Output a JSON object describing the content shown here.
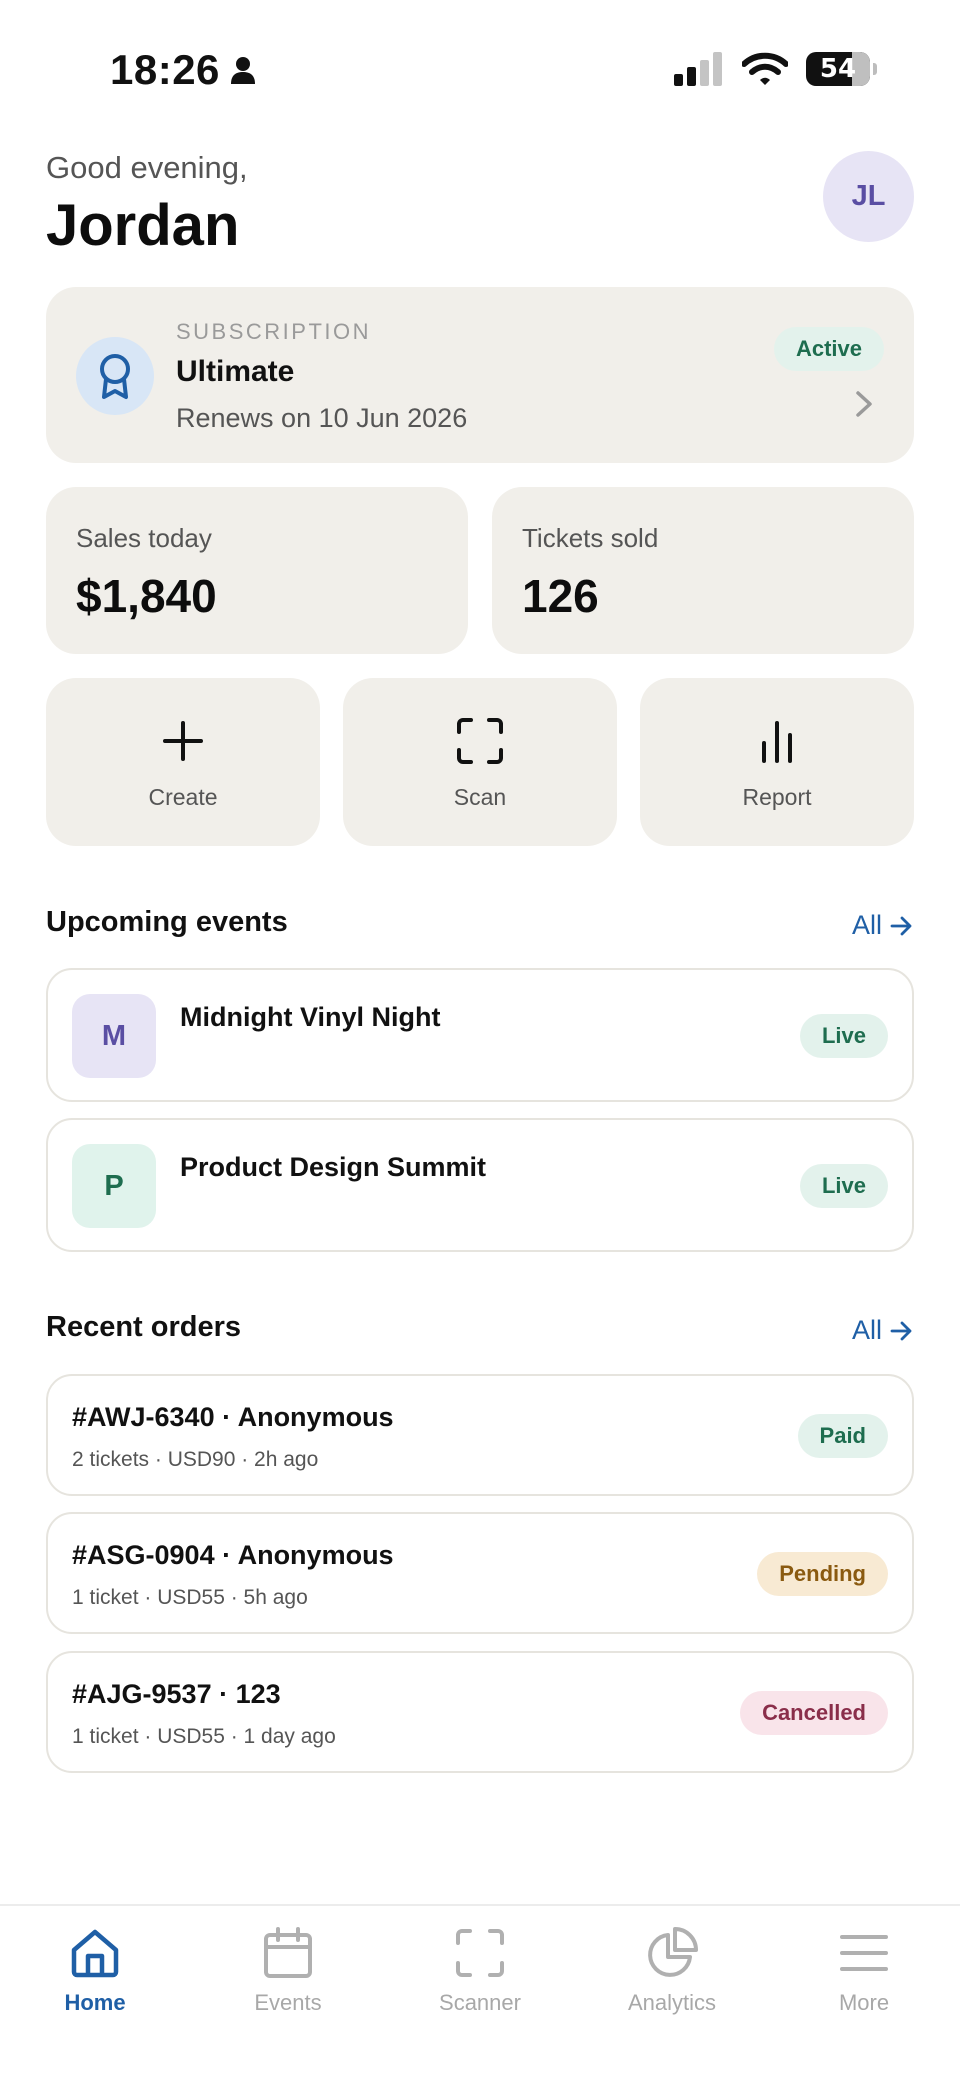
{
  "status_bar": {
    "time": "18:26",
    "battery": "54"
  },
  "header": {
    "greeting": "Good evening,",
    "name": "Jordan",
    "avatar_initials": "JL"
  },
  "subscription": {
    "kicker": "SUBSCRIPTION",
    "plan": "Ultimate",
    "renewal": "Renews on 10 Jun 2026",
    "status": "Active",
    "icon": "award-ribbon-icon"
  },
  "stats": [
    {
      "label": "Sales today",
      "value": "$1,840"
    },
    {
      "label": "Tickets sold",
      "value": "126"
    }
  ],
  "actions": [
    {
      "label": "Create",
      "icon": "plus-icon"
    },
    {
      "label": "Scan",
      "icon": "scan-frame-icon"
    },
    {
      "label": "Report",
      "icon": "bar-chart-icon"
    }
  ],
  "upcoming": {
    "title": "Upcoming events",
    "link": "All",
    "events": [
      {
        "initial": "M",
        "name": "Midnight Vinyl Night",
        "status": "Live",
        "tile_color": "#e7e4f5",
        "initial_color": "#5a4ea3"
      },
      {
        "initial": "P",
        "name": "Product Design Summit",
        "status": "Live",
        "tile_color": "#e0f3ec",
        "initial_color": "#1e6d4f"
      }
    ]
  },
  "orders": {
    "title": "Recent orders",
    "link": "All",
    "items": [
      {
        "title": "#AWJ-6340 · Anonymous",
        "meta": "2 tickets · USD90 · 2h ago",
        "status": "Paid"
      },
      {
        "title": "#ASG-0904 · Anonymous",
        "meta": "1 ticket · USD55 · 5h ago",
        "status": "Pending"
      },
      {
        "title": "#AJG-9537 · 123",
        "meta": "1 ticket · USD55 · 1 day ago",
        "status": "Cancelled"
      }
    ]
  },
  "tabs": [
    {
      "label": "Home",
      "icon": "home-icon",
      "active": true
    },
    {
      "label": "Events",
      "icon": "calendar-icon",
      "active": false
    },
    {
      "label": "Scanner",
      "icon": "scan-frame-icon",
      "active": false
    },
    {
      "label": "Analytics",
      "icon": "pie-chart-icon",
      "active": false
    },
    {
      "label": "More",
      "icon": "menu-icon",
      "active": false
    }
  ],
  "colors": {
    "accent": "#1f5fa6",
    "card": "#f1efea",
    "success": "#1e6d4f"
  }
}
